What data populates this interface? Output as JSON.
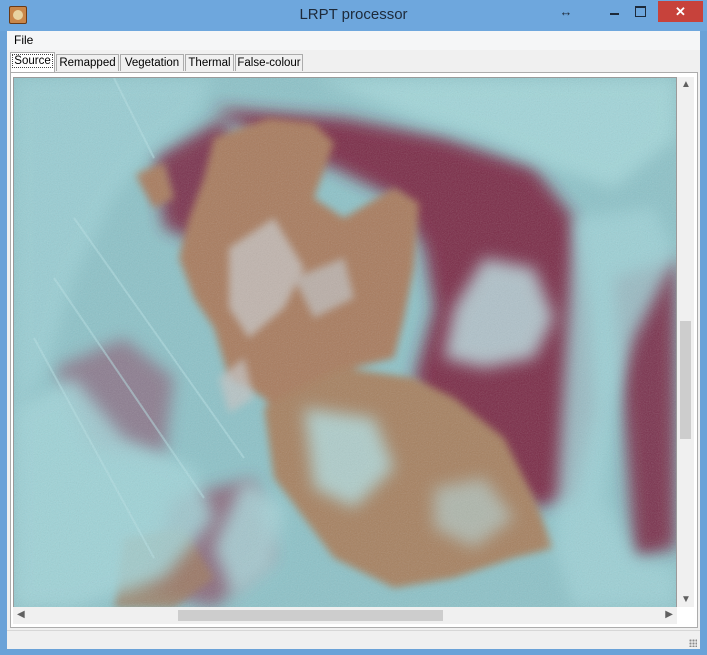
{
  "window": {
    "title": "LRPT processor",
    "icon": "app-satellite-icon",
    "buttons": {
      "minimize": "minimize-icon",
      "maximize": "maximize-icon",
      "close": "close-icon",
      "resize": "resize-icon"
    }
  },
  "menu": {
    "file": "File"
  },
  "tabs": [
    {
      "label": "Source",
      "active": true
    },
    {
      "label": "Remapped",
      "active": false
    },
    {
      "label": "Vegetation",
      "active": false
    },
    {
      "label": "Thermal",
      "active": false
    },
    {
      "label": "False-colour",
      "active": false
    }
  ],
  "image": {
    "description_colors": {
      "sea": "#7a2a46",
      "land": "#a87c5e",
      "cloud": "#9ed4d8"
    }
  },
  "scrollbars": {
    "vertical_position": 0.43,
    "horizontal_position": 0.26
  }
}
